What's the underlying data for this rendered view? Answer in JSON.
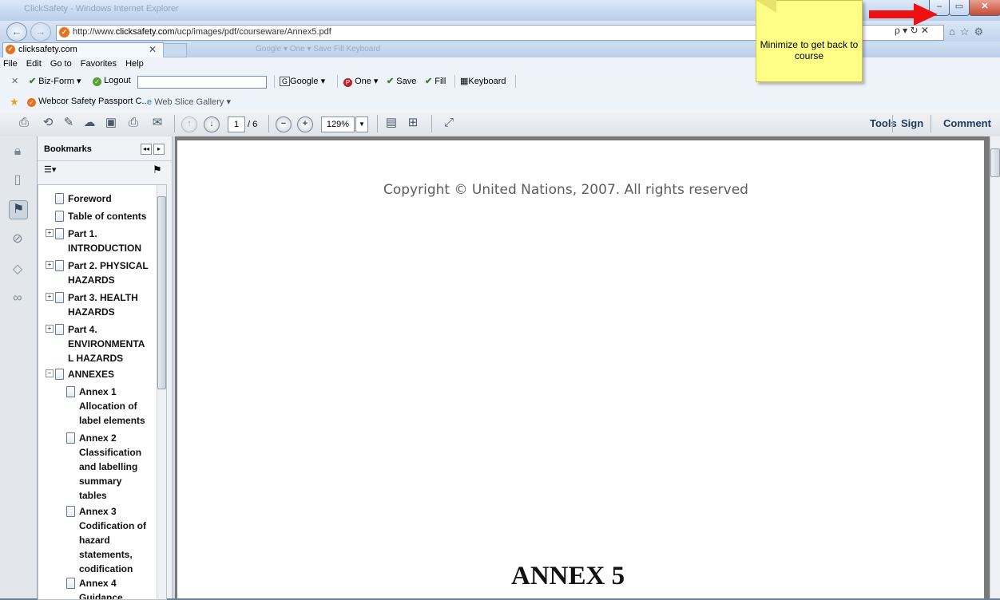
{
  "window": {
    "title": "ClickSafety - Windows Internet Explorer"
  },
  "browser": {
    "url_prefix": "http://www.",
    "url_domain": "clicksafety.com",
    "url_path": "/ucp/images/pdf/courseware/Annex5.pdf",
    "search_controls": "ρ ▾ ↻ ✕",
    "tab_label": "clicksafety.com",
    "ghost_toolbar": "Google ▾   One ▾   Save   Fill   Keyboard"
  },
  "menu": [
    "File",
    "Edit",
    "Go to",
    "Favorites",
    "Help"
  ],
  "toolbar": {
    "close": "✕",
    "bizform": "Biz-Form ▾",
    "logout": "Logout",
    "google": "Google",
    "one": "One ▾",
    "save": "Save",
    "fill": "Fill",
    "keyboard": "Keyboard"
  },
  "favorites": {
    "item1": "Webcor Safety Passport C...",
    "item2": "Web Slice Gallery ▾"
  },
  "acrobat": {
    "page_current": "1",
    "page_total": "/ 6",
    "zoom": "129%",
    "tools": "Tools",
    "sign": "Sign",
    "comment": "Comment"
  },
  "bookmarks": {
    "title": "Bookmarks",
    "items": [
      "Foreword",
      "Table of contents",
      "Part 1.",
      "INTRODUCTION",
      "Part 2. PHYSICAL",
      "HAZARDS",
      "Part 3. HEALTH",
      "HAZARDS",
      "Part 4.",
      "ENVIRONMENTA",
      "L HAZARDS",
      "ANNEXES",
      "Annex 1",
      "Allocation of",
      "label elements",
      "Annex 2",
      "Classification",
      "and labelling",
      "summary",
      "tables",
      "Annex 3",
      "Codification of",
      "hazard",
      "statements,",
      "codification",
      "Annex 4",
      "Guidance"
    ]
  },
  "document": {
    "copyright": "Copyright © United Nations, 2007. All rights reserved",
    "heading": "ANNEX 5"
  },
  "overlay": {
    "sticky_text": "Minimize to get back to course",
    "arrow_color": "#ee1111"
  }
}
